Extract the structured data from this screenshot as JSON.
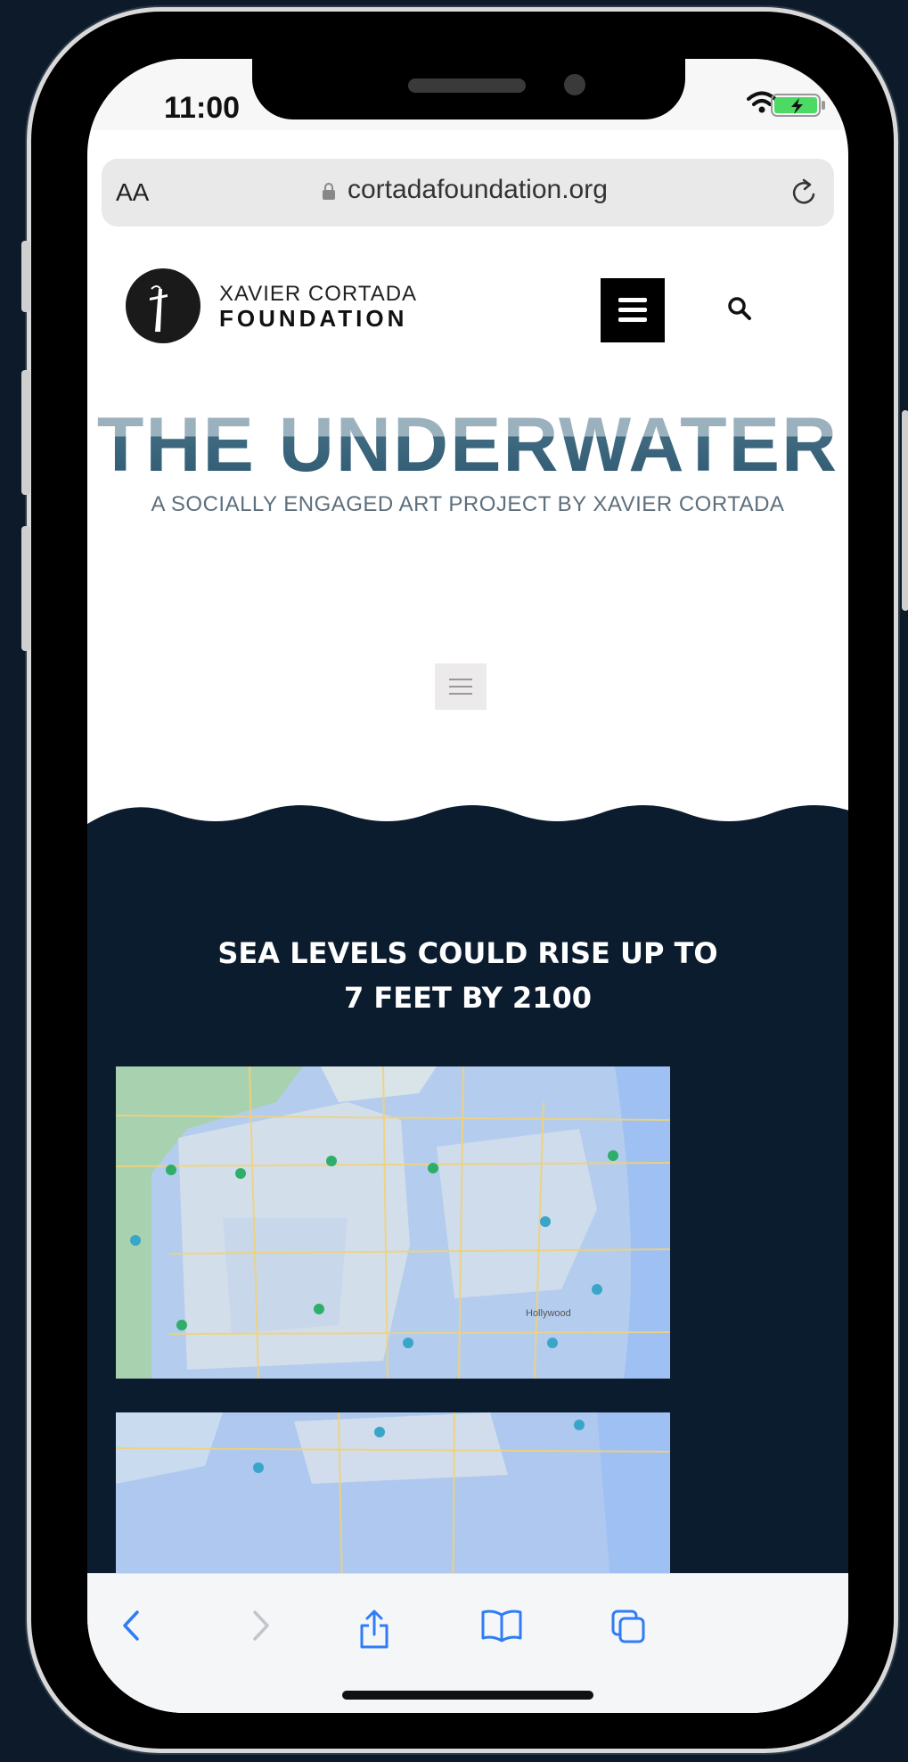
{
  "status_bar": {
    "time": "11:00"
  },
  "browser": {
    "aa_label": "AA",
    "url": "cortadafoundation.org"
  },
  "site_header": {
    "logo_line1": "XAVIER CORTADA",
    "logo_line2": "FOUNDATION"
  },
  "hero": {
    "title": "THE UNDERWATER",
    "subtitle": "A SOCIALLY ENGAGED ART PROJECT BY XAVIER CORTADA"
  },
  "content": {
    "headline_line1": "SEA LEVELS COULD RISE UP TO",
    "headline_line2": "7 FEET BY 2100",
    "map_label_hollywood": "Hollywood"
  },
  "toolbar": {
    "icons": [
      "back-icon",
      "forward-icon",
      "share-icon",
      "bookmarks-icon",
      "tabs-icon"
    ]
  },
  "colors": {
    "dark_navy": "#0b1c2f",
    "title_light": "#9bb1bd",
    "title_dark": "#2e5870",
    "ios_blue": "#2f7cf6",
    "map_flood": "#a9c7f2"
  }
}
